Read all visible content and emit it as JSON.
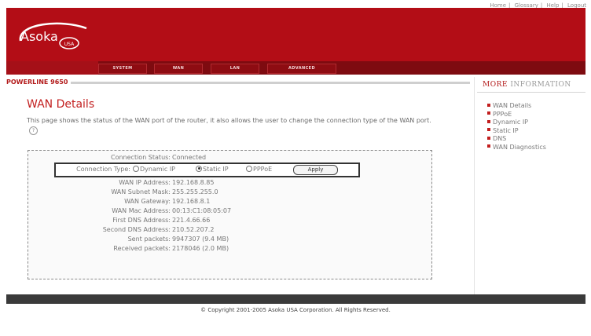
{
  "top_links": [
    "Home",
    "Glossary",
    "Help",
    "Logout"
  ],
  "brand": {
    "name": "Asoka",
    "sub": "USA"
  },
  "nav": [
    "SYSTEM",
    "WAN",
    "LAN",
    "ADVANCED"
  ],
  "product_label": "POWERLINE 9650",
  "sidebar": {
    "title_strong": "MORE",
    "title_rest": "INFORMATION",
    "items": [
      "WAN Details",
      "PPPoE",
      "Dynamic IP",
      "Static IP",
      "DNS",
      "WAN Diagnostics"
    ]
  },
  "main": {
    "title": "WAN Details",
    "description": "This page shows the status of the WAN port of the router, it also allows the user to change the connection type of the WAN port.",
    "help_icon_text": "?",
    "status": {
      "label": "Connection Status:",
      "value": "Connected"
    },
    "connection_type": {
      "label": "Connection Type:",
      "options": [
        "Dynamic IP",
        "Static IP",
        "PPPoE"
      ],
      "selected": "Static IP",
      "apply_label": "Apply"
    },
    "details": [
      {
        "label": "WAN IP Address:",
        "value": "192.168.8.85"
      },
      {
        "label": "WAN Subnet Mask:",
        "value": "255.255.255.0"
      },
      {
        "label": "WAN Gateway:",
        "value": "192.168.8.1"
      },
      {
        "label": "WAN Mac Address:",
        "value": "00:13:C1:08:05:07"
      },
      {
        "label": "First DNS Address:",
        "value": "221.4.66.66"
      },
      {
        "label": "Second DNS Address:",
        "value": "210.52.207.2"
      },
      {
        "label": "Sent packets:",
        "value": "9947307 (9.4 MB)"
      },
      {
        "label": "Received packets:",
        "value": "2178046 (2.0 MB)"
      }
    ]
  },
  "footer": {
    "copyright": "© Copyright 2001-2005   Asoka USA Corporation. All Rights Reserved."
  },
  "colors": {
    "brand_red": "#b30d16",
    "nav_dark": "#7e0b10",
    "footer": "#3a3a3a",
    "accent": "#c21e1e"
  }
}
